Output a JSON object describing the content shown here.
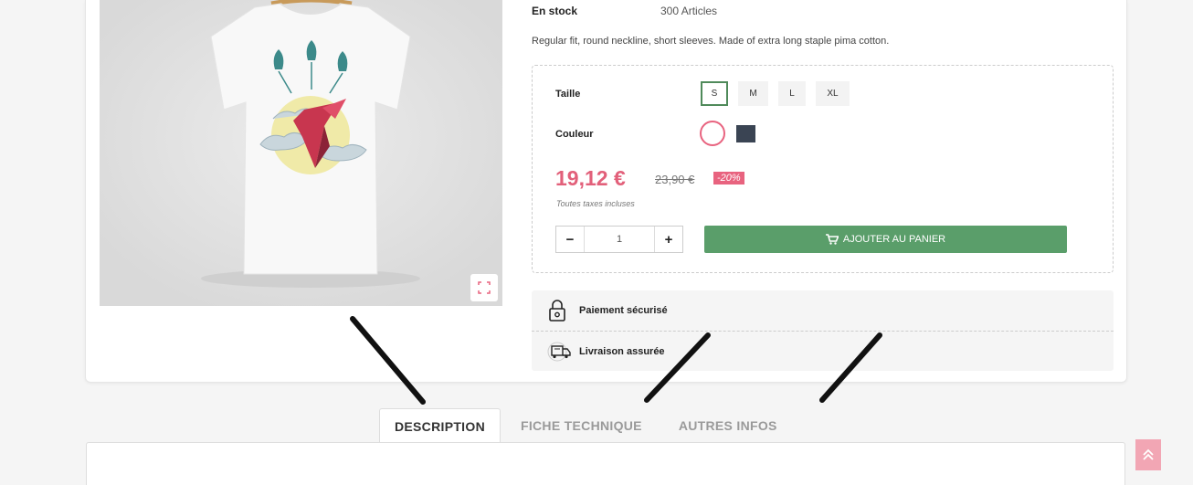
{
  "product": {
    "stock_label": "En stock",
    "stock_value": "300 Articles",
    "description": "Regular fit, round neckline, short sleeves. Made of extra long staple pima cotton."
  },
  "variants": {
    "size_label": "Taille",
    "sizes": [
      "S",
      "M",
      "L",
      "XL"
    ],
    "selected_size": "S",
    "color_label": "Couleur",
    "colors": [
      "#ffffff",
      "#3a4453"
    ]
  },
  "price": {
    "current": "19,12 €",
    "old": "23,90 €",
    "discount": "-20%",
    "tax_note": "Toutes taxes incluses"
  },
  "cart": {
    "quantity": "1",
    "minus": "−",
    "plus": "+",
    "add_label": "AJOUTER AU PANIER"
  },
  "reassurance": {
    "payment": "Paiement sécurisé",
    "delivery": "Livraison assurée"
  },
  "tabs": [
    "DESCRIPTION",
    "FICHE TECHNIQUE",
    "AUTRES INFOS"
  ],
  "colors": {
    "accent_green": "#5a9e6a",
    "price_pink": "#e2607a"
  }
}
